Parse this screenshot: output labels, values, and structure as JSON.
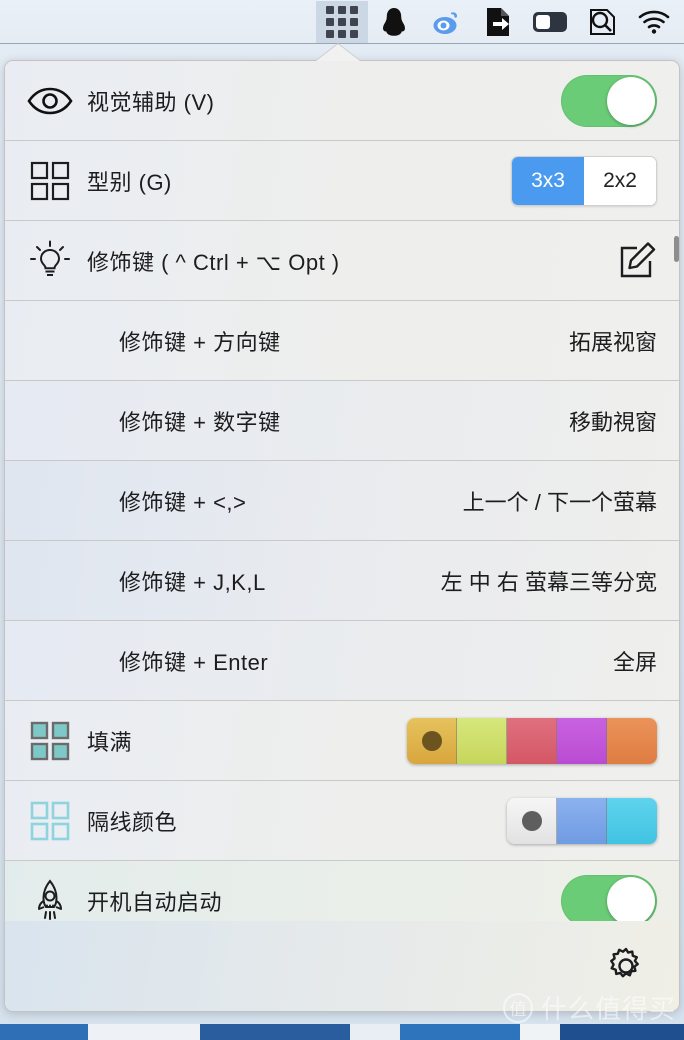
{
  "menubar": {
    "items": [
      {
        "name": "grid-icon",
        "label": "",
        "active": true
      },
      {
        "name": "qq-penguin-icon",
        "label": "",
        "active": false
      },
      {
        "name": "weibo-icon",
        "label": "",
        "active": false
      },
      {
        "name": "document-export-icon",
        "label": "",
        "active": false
      },
      {
        "name": "display-toggle-icon",
        "label": "",
        "active": false
      },
      {
        "name": "search-icon",
        "label": "",
        "active": false
      },
      {
        "name": "wifi-icon",
        "label": "",
        "active": false
      }
    ]
  },
  "panel": {
    "rows": [
      {
        "id": "visual-assist",
        "icon": "eye-icon",
        "label": "视觉辅助 (V)",
        "control": "toggle",
        "toggle_on": true
      },
      {
        "id": "grid-type",
        "icon": "grid-2x2-icon",
        "label": "型别 (G)",
        "control": "segmented",
        "options": [
          "3x3",
          "2x2"
        ],
        "selected": "3x3"
      },
      {
        "id": "modifier-keys",
        "icon": "lightbulb-icon",
        "label": "修饰键 (  ^ Ctrl + ⌥ Opt  )",
        "control": "edit-icon"
      },
      {
        "id": "modifier-arrow",
        "icon": "",
        "label": "修饰键 + 方向键",
        "control": "text",
        "value": "拓展视窗"
      },
      {
        "id": "modifier-number",
        "icon": "",
        "label": "修饰键 + 数字键",
        "control": "text",
        "value": "移動視窗"
      },
      {
        "id": "modifier-anglebrackets",
        "icon": "",
        "label": "修饰键 + <,>",
        "control": "text",
        "value": "上一个 / 下一个萤幕"
      },
      {
        "id": "modifier-jkl",
        "icon": "",
        "label": "修饰键 + J,K,L",
        "control": "text",
        "value": "左 中 右 萤幕三等分宽"
      },
      {
        "id": "modifier-enter",
        "icon": "",
        "label": "修饰键 + Enter",
        "control": "text",
        "value": "全屏"
      },
      {
        "id": "fill-color",
        "icon": "grid-filled-icon",
        "label": "填满",
        "control": "swatches",
        "swatches": [
          "#e0b44c",
          "#cfdd69",
          "#dd6272",
          "#c256d9",
          "#e5894d"
        ],
        "selected_index": 0,
        "selected_dot_color": "#6b5420"
      },
      {
        "id": "divider-color",
        "icon": "grid-outline-icon",
        "label": "隔线颜色",
        "control": "swatches",
        "swatches": [
          "#ececec",
          "#7fa6e8",
          "#4cc8e8"
        ],
        "selected_index": 0,
        "selected_dot_color": "#5e5e5e"
      },
      {
        "id": "launch-at-login",
        "icon": "rocket-icon",
        "label": "开机自动启动",
        "control": "toggle",
        "toggle_on": true
      }
    ],
    "footer": {
      "settings_icon": "gear-icon"
    }
  },
  "watermark": {
    "badge": "值",
    "text": "什么值得买"
  },
  "colors": {
    "accent_blue": "#4a9bf0",
    "toggle_green": "#6bcc77",
    "panel_bg": "#efefef",
    "menubar_active": "#ccd7e6"
  }
}
